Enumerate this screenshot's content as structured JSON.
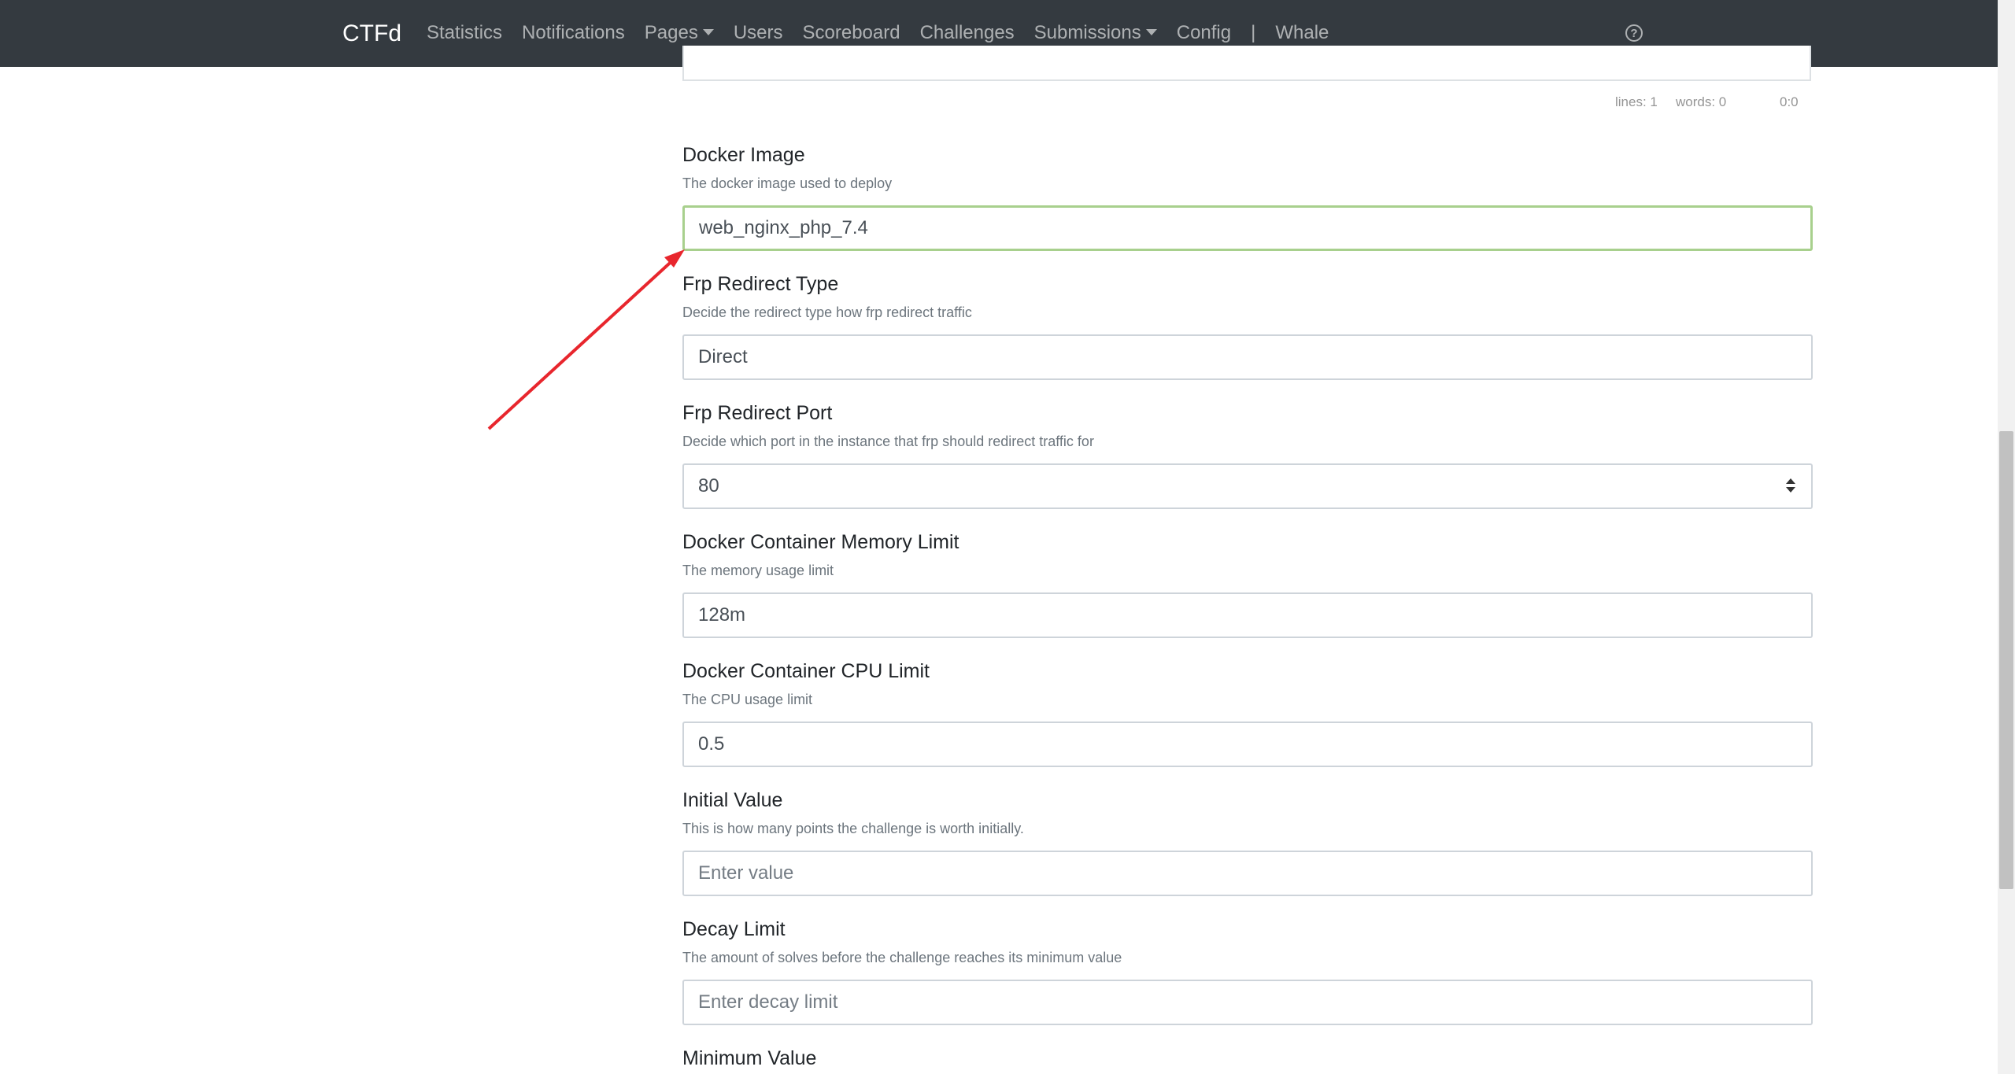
{
  "nav": {
    "brand": "CTFd",
    "items": [
      {
        "label": "Statistics",
        "dropdown": false
      },
      {
        "label": "Notifications",
        "dropdown": false
      },
      {
        "label": "Pages",
        "dropdown": true
      },
      {
        "label": "Users",
        "dropdown": false
      },
      {
        "label": "Scoreboard",
        "dropdown": false
      },
      {
        "label": "Challenges",
        "dropdown": false
      },
      {
        "label": "Submissions",
        "dropdown": true
      },
      {
        "label": "Config",
        "dropdown": false
      }
    ],
    "separator": "|",
    "plugin": "Whale",
    "help_icon": "question-circle-icon"
  },
  "editor": {
    "lines": "lines: 1",
    "words": "words: 0",
    "cursor": "0:0"
  },
  "form": {
    "docker_image": {
      "label": "Docker Image",
      "help": "The docker image used to deploy",
      "value": "web_nginx_php_7.4"
    },
    "frp_redirect_type": {
      "label": "Frp Redirect Type",
      "help": "Decide the redirect type how frp redirect traffic",
      "value": "Direct"
    },
    "frp_redirect_port": {
      "label": "Frp Redirect Port",
      "help": "Decide which port in the instance that frp should redirect traffic for",
      "value": "80"
    },
    "memory_limit": {
      "label": "Docker Container Memory Limit",
      "help": "The memory usage limit",
      "value": "128m"
    },
    "cpu_limit": {
      "label": "Docker Container CPU Limit",
      "help": "The CPU usage limit",
      "value": "0.5"
    },
    "initial_value": {
      "label": "Initial Value",
      "help": "This is how many points the challenge is worth initially.",
      "placeholder": "Enter value"
    },
    "decay_limit": {
      "label": "Decay Limit",
      "help": "The amount of solves before the challenge reaches its minimum value",
      "placeholder": "Enter decay limit"
    },
    "minimum_value": {
      "label": "Minimum Value"
    }
  },
  "colors": {
    "navbar": "#343a40",
    "focus_border": "#a8d08d",
    "annotation_arrow": "#e8262d"
  }
}
